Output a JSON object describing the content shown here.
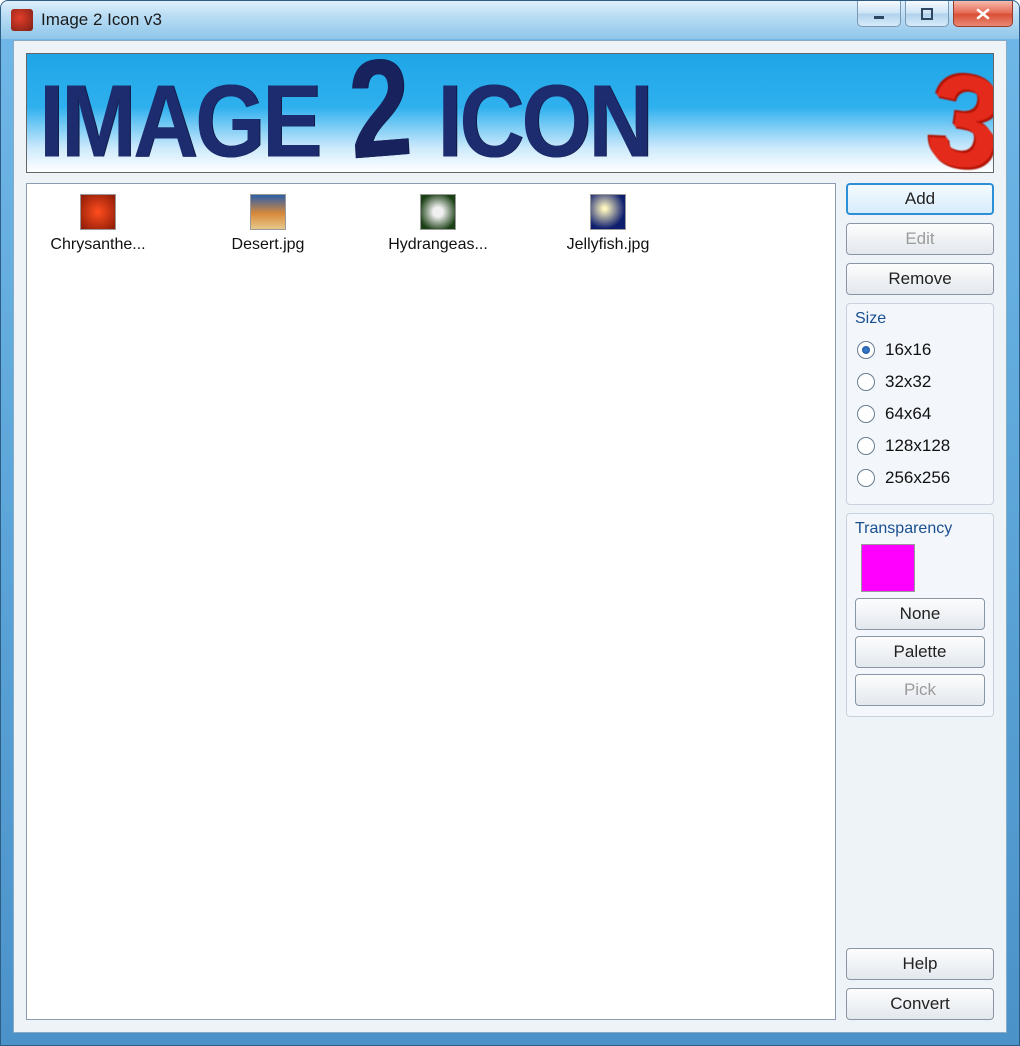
{
  "window": {
    "title": "Image 2 Icon v3"
  },
  "banner": {
    "word1": "IMAGE",
    "two": "2",
    "word2": "ICON",
    "three": "3"
  },
  "files": [
    {
      "label": "Chrysanthe..."
    },
    {
      "label": "Desert.jpg"
    },
    {
      "label": "Hydrangeas..."
    },
    {
      "label": "Jellyfish.jpg"
    }
  ],
  "buttons": {
    "add": "Add",
    "edit": "Edit",
    "remove": "Remove",
    "none": "None",
    "palette": "Palette",
    "pick": "Pick",
    "help": "Help",
    "convert": "Convert"
  },
  "size": {
    "legend": "Size",
    "options": [
      "16x16",
      "32x32",
      "64x64",
      "128x128",
      "256x256"
    ],
    "selected": "16x16"
  },
  "transparency": {
    "legend": "Transparency",
    "color": "#ff00ff"
  }
}
